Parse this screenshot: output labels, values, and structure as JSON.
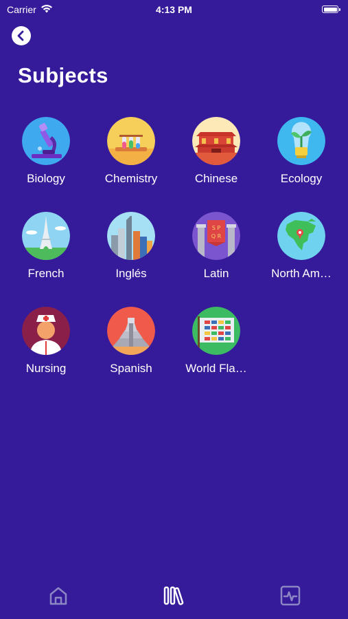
{
  "status_bar": {
    "carrier": "Carrier",
    "time": "4:13 PM"
  },
  "page": {
    "title": "Subjects"
  },
  "subjects": [
    {
      "label": "Biology",
      "icon": "microscope-icon"
    },
    {
      "label": "Chemistry",
      "icon": "test-tubes-icon"
    },
    {
      "label": "Chinese",
      "icon": "forbidden-city-icon"
    },
    {
      "label": "Ecology",
      "icon": "sprout-lightbulb-icon"
    },
    {
      "label": "French",
      "icon": "eiffel-tower-icon"
    },
    {
      "label": "Inglés",
      "icon": "city-skyline-icon"
    },
    {
      "label": "Latin",
      "icon": "spqr-banner-icon"
    },
    {
      "label": "North Am…",
      "icon": "north-america-map-icon"
    },
    {
      "label": "Nursing",
      "icon": "nurse-icon"
    },
    {
      "label": "Spanish",
      "icon": "pyramid-icon"
    },
    {
      "label": "World Fla…",
      "icon": "world-flags-icon"
    }
  ],
  "tab_bar": {
    "items": [
      "home-icon",
      "library-icon",
      "activity-icon"
    ],
    "active": "library-icon"
  },
  "colors": {
    "background": "#351a9a",
    "tab_inactive": "#8c87c4",
    "tab_active": "#ffffff"
  }
}
